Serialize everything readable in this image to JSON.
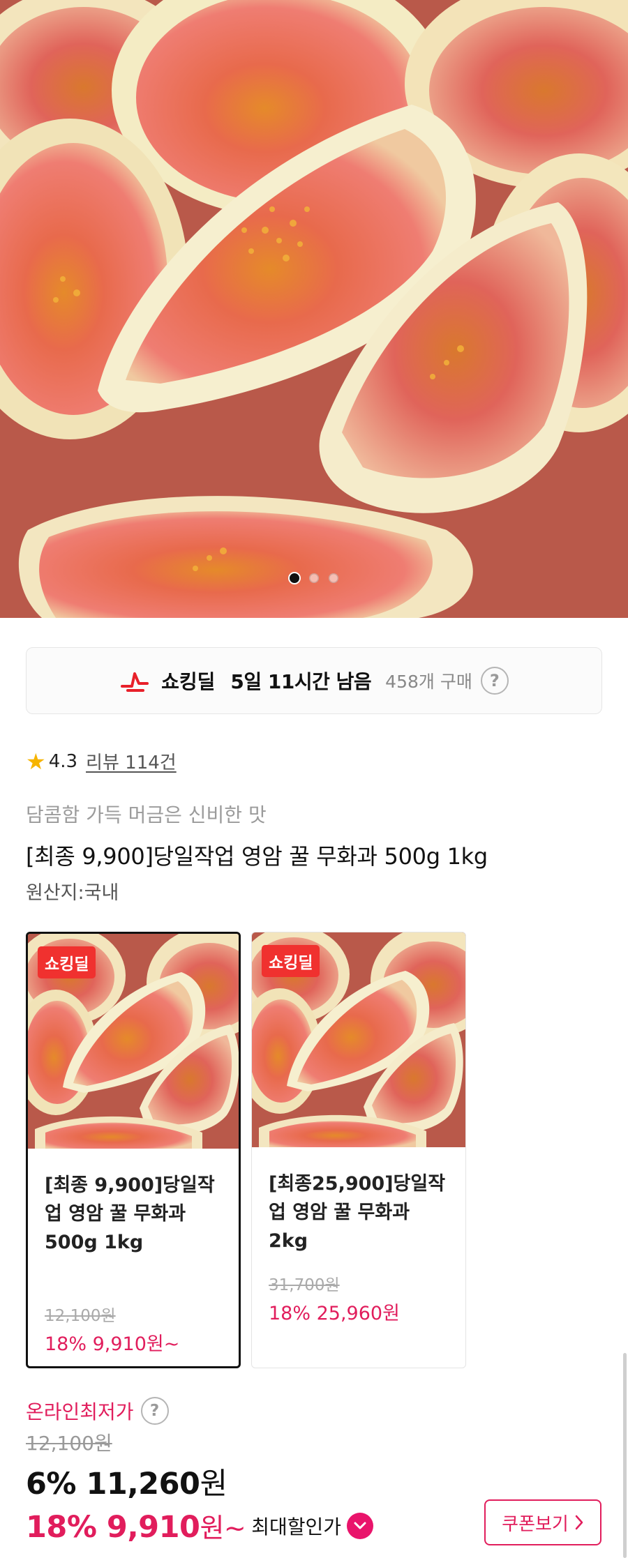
{
  "hero": {
    "image_alt": "figs",
    "dots_total": 3,
    "active_dot": 1
  },
  "deal": {
    "label": "쇼킹딜",
    "time_left": "5일 11시간 남음",
    "purchase_count": "458개 구매",
    "help": "?"
  },
  "rating": {
    "score": "4.3",
    "review_link": "리뷰 114건"
  },
  "product": {
    "subtitle": "담콤함 가득 머금은 신비한 맛",
    "title": "[최종 9,900]당일작업 영암 꿀 무화과 500g 1kg",
    "origin": "원산지:국내"
  },
  "options": [
    {
      "badge": "쇼킹딜",
      "title": "[최종 9,900]당일작업 영암 꿀 무화과 500g 1kg",
      "original_price": "12,100원",
      "price": "18% 9,910원~",
      "selected": true
    },
    {
      "badge": "쇼킹딜",
      "title": "[최종25,900]당일작업 영암 꿀 무화과 2kg",
      "original_price": "31,700원",
      "price": "18% 25,960원",
      "selected": false
    }
  ],
  "price": {
    "lowest_label": "온라인최저가",
    "help": "?",
    "original": "12,100원",
    "sale_percent": "6%",
    "sale_amount": "11,260",
    "won": "원",
    "max_percent": "18%",
    "max_amount": "9,910",
    "max_suffix": "원~",
    "max_label": "최대할인가",
    "coupon_button": "쿠폰보기"
  },
  "colors": {
    "accent_pink": "#e11d5c",
    "badge_red": "#f0312f",
    "star": "#f6b400"
  }
}
